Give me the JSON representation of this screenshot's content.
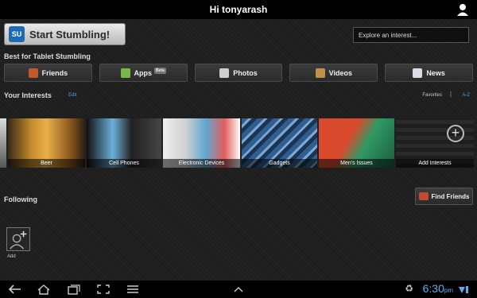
{
  "header": {
    "greeting": "Hi tonyarash"
  },
  "stumble": {
    "label": "Start Stumbling!",
    "logo_text": "SU"
  },
  "search": {
    "placeholder": "Explore an interest..."
  },
  "best_for": {
    "heading": "Best for Tablet Stumbling",
    "categories": [
      {
        "label": "Friends",
        "icon": "friends-icon",
        "color": "#c2572b"
      },
      {
        "label": "Apps",
        "icon": "apps-icon",
        "color": "#7ab648",
        "badge": "Beta"
      },
      {
        "label": "Photos",
        "icon": "camera-icon",
        "color": "#cfcfcf"
      },
      {
        "label": "Videos",
        "icon": "tv-icon",
        "color": "#c0914a"
      },
      {
        "label": "News",
        "icon": "news-icon",
        "color": "#d9dde5"
      }
    ]
  },
  "interests": {
    "heading": "Your Interests",
    "edit_label": "Edit",
    "favorites_label": "Favorites",
    "separator": "|",
    "az_label": "A-Z",
    "tiles": [
      {
        "label": "Beer"
      },
      {
        "label": "Cell Phones"
      },
      {
        "label": "Electronic Devices"
      },
      {
        "label": "Gadgets"
      },
      {
        "label": "Men's Issues"
      },
      {
        "label": "Add Interests"
      }
    ]
  },
  "following": {
    "heading": "Following",
    "find_label": "Find Friends",
    "add_label": "Add"
  },
  "system_bar": {
    "time": "6:30",
    "ampm": "pm"
  },
  "colors": {
    "accent": "#4aa3e8",
    "stumble_logo": "#1b6bb5"
  }
}
